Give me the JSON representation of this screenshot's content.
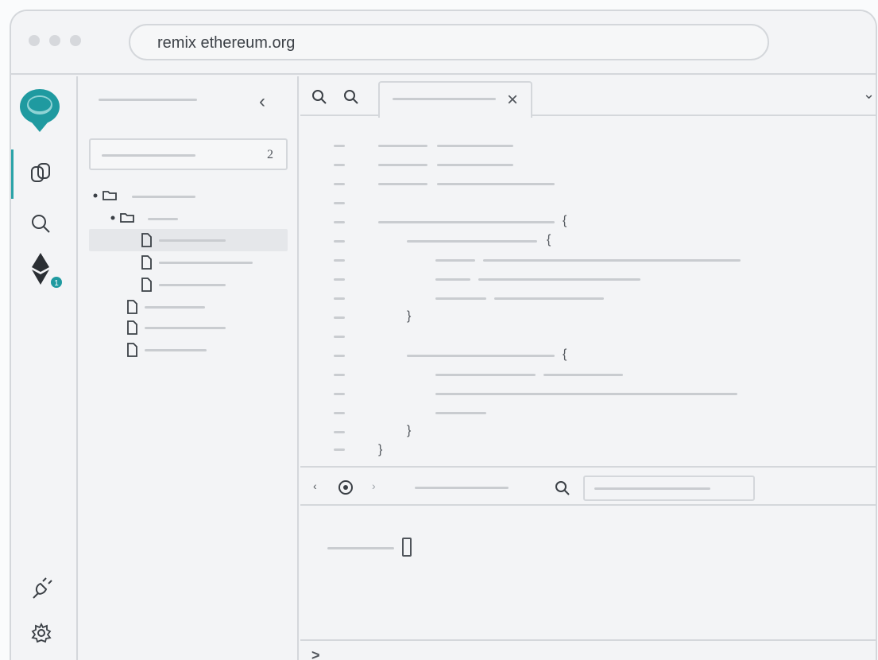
{
  "browser": {
    "url": "remix ethereum.org"
  },
  "sidepanel": {
    "collapse_glyph": "‹",
    "filter_count": "2"
  },
  "editor": {
    "close_glyph": "×",
    "menu_glyph": "⌄"
  },
  "terminal": {
    "prompt_glyph": ">"
  },
  "badges": {
    "deploy_badge": "1"
  },
  "colors": {
    "accent": "#2aa3a8",
    "logo": "#1f9aa0"
  },
  "icons": [
    "remix-logo-icon",
    "file-explorer-icon",
    "search-icon",
    "ethereum-icon",
    "plugin-icon",
    "settings-icon",
    "zoom-out-icon",
    "zoom-in-icon",
    "folder-icon",
    "file-icon",
    "terminal-search-icon"
  ]
}
